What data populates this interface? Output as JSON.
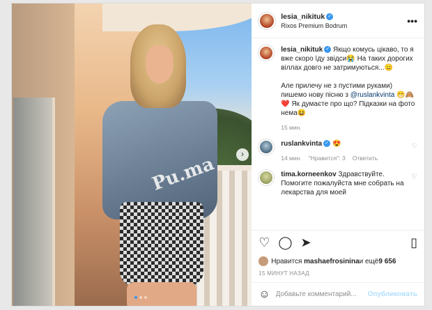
{
  "author": {
    "username": "lesia_nikituk",
    "location": "Rixos Premium Bodrum",
    "more_label": "•••"
  },
  "photo": {
    "next_label": "›",
    "dot_count": 3,
    "jacket_text": "Pu.ma"
  },
  "caption": {
    "username": "lesia_nikituk",
    "text_1": "Якщо комусь цікаво, то я вже скоро їду звідси😭 На таких дорогих віллах довго не затримуються...😑",
    "text_2a": "Але прилечу не з пустими руками) пишемо нову пісню з ",
    "mention": "@ruslankvinta",
    "text_2b": " 😁🙈❤️ Як думаєте про що? Підказки на фото нема😆",
    "time": "15 мин."
  },
  "comments": [
    {
      "username": "ruslankvinta",
      "text": "😍",
      "time": "14 мин.",
      "likes": "\"Нравится\": 3",
      "reply": "Ответить"
    },
    {
      "username": "tima.korneenkov",
      "text": "Здравствуйте. Помогите пожалуйста мне собрать на лекарства для моей"
    }
  ],
  "actions": {
    "like_icon": "♡",
    "comment_icon": "◯",
    "share_icon": "➤",
    "save_icon": "▯"
  },
  "likes": {
    "prefix": "Нравится",
    "user": "mashaefrosinina",
    "suffix": " и ещё ",
    "count": "9 656"
  },
  "posted": "15 МИНУТ НАЗАД",
  "add_comment": {
    "placeholder": "Добавьте комментарий...",
    "post_label": "Опубликовать",
    "emoji_icon": "☺"
  }
}
